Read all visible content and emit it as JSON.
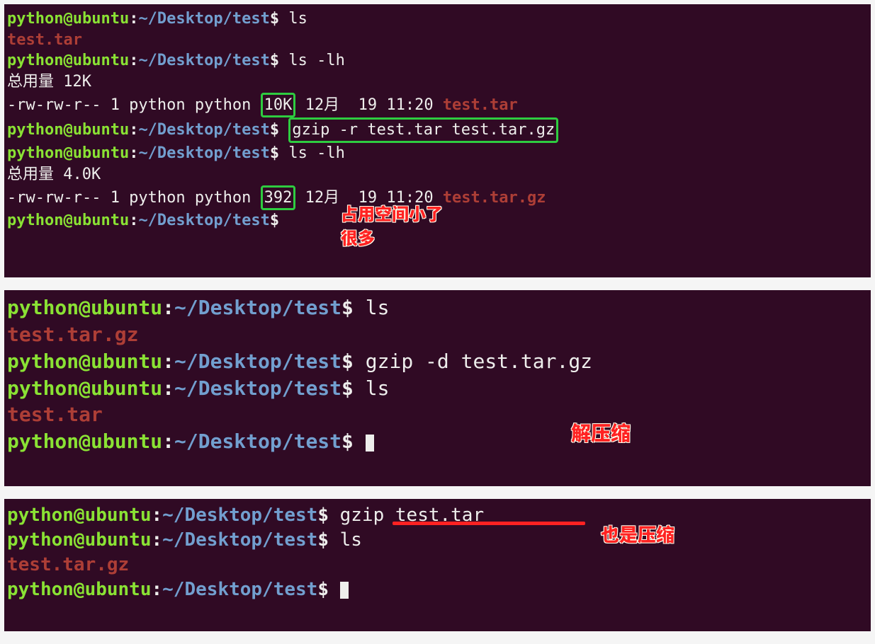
{
  "prompt": {
    "user": "python@ubuntu",
    "colon": ":",
    "path": "~/Desktop/test",
    "dollar": "$"
  },
  "panel1": {
    "cmd1": "ls",
    "out1_file": "test.tar",
    "cmd2": "ls -lh",
    "total1": "总用量 12K",
    "perms1a": "-rw-rw-r-- 1 python python ",
    "size1": "10K",
    "date1": " 12月  19 11:20 ",
    "file1": "test.tar",
    "cmd3": "gzip -r test.tar test.tar.gz",
    "cmd4": "ls -lh",
    "total2": "总用量 4.0K",
    "perms2a": "-rw-rw-r-- 1 python python ",
    "size2": "392",
    "date2": " 12月  19 11:20 ",
    "file2": "test.tar.gz",
    "note": "占用空间小了\n很多"
  },
  "panel2": {
    "cmd1": "ls",
    "file1": "test.tar.gz",
    "cmd2": "gzip -d test.tar.gz",
    "cmd3": "ls",
    "file2": "test.tar",
    "note": "解压缩"
  },
  "panel3": {
    "cmd1": "gzip test.tar",
    "cmd2": "ls",
    "file1": "test.tar.gz",
    "note": "也是压缩"
  }
}
